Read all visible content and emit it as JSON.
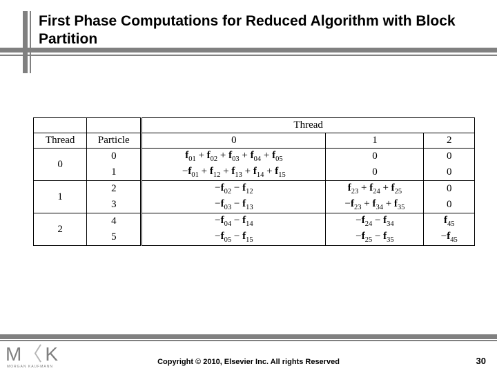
{
  "title": "First Phase Computations for Reduced Algorithm with Block Partition",
  "table": {
    "header_top": "Thread",
    "col_labels": {
      "thread": "Thread",
      "particle": "Particle",
      "c0": "0",
      "c1": "1",
      "c2": "2"
    },
    "groups": [
      {
        "thread": "0",
        "rows": [
          {
            "particle": "0",
            "c0": "f01 + f02 + f03 + f04 + f05",
            "c1": "0",
            "c2": "0"
          },
          {
            "particle": "1",
            "c0": "−f01 + f12 + f13 + f14 + f15",
            "c1": "0",
            "c2": "0"
          }
        ]
      },
      {
        "thread": "1",
        "rows": [
          {
            "particle": "2",
            "c0": "−f02 − f12",
            "c1": "f23 + f24 + f25",
            "c2": "0"
          },
          {
            "particle": "3",
            "c0": "−f03 − f13",
            "c1": "−f23 + f34 + f35",
            "c2": "0"
          }
        ]
      },
      {
        "thread": "2",
        "rows": [
          {
            "particle": "4",
            "c0": "−f04 − f14",
            "c1": "−f24 − f34",
            "c2": "f45"
          },
          {
            "particle": "5",
            "c0": "−f05 − f15",
            "c1": "−f25 − f35",
            "c2": "−f45"
          }
        ]
      }
    ]
  },
  "logo": {
    "m": "M",
    "sep": "〈",
    "k": "K",
    "sub": "MORGAN KAUFMANN"
  },
  "copyright": "Copyright © 2010, Elsevier Inc. All rights Reserved",
  "page": "30"
}
